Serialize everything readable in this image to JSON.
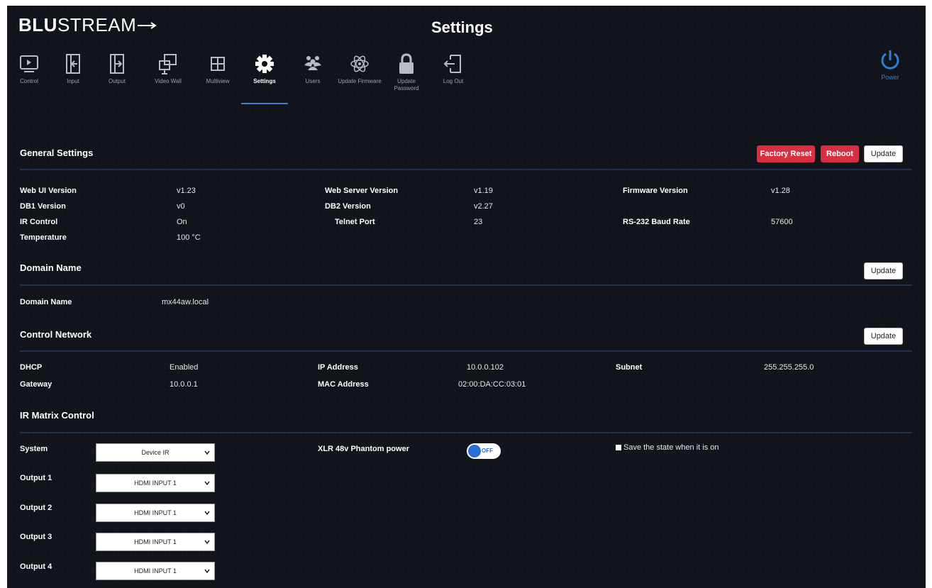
{
  "header": {
    "logo_bold": "BLU",
    "logo_light": "STREAM",
    "title": "Settings"
  },
  "nav": [
    {
      "label": "Control",
      "icon": "control-screen-icon"
    },
    {
      "label": "Input",
      "icon": "input-icon"
    },
    {
      "label": "Output",
      "icon": "output-icon"
    },
    {
      "label": "Video Wall",
      "icon": "video-wall-icon"
    },
    {
      "label": "Multiview",
      "icon": "multiview-icon"
    },
    {
      "label": "Settings",
      "icon": "gear-icon",
      "active": true
    },
    {
      "label": "Users",
      "icon": "users-icon"
    },
    {
      "label": "Update Firmware",
      "icon": "atom-icon"
    },
    {
      "label": "Update Password",
      "icon": "lock-icon"
    },
    {
      "label": "Log Out",
      "icon": "logout-icon"
    }
  ],
  "power": {
    "label": "Power",
    "icon": "power-icon"
  },
  "general": {
    "title": "General Settings",
    "factory_reset": "Factory Reset",
    "reboot": "Reboot",
    "update": "Update",
    "web_ui_version_label": "Web UI Version",
    "web_ui_version": "v1.23",
    "web_server_version_label": "Web Server Version",
    "web_server_version": "v1.19",
    "firmware_version_label": "Firmware Version",
    "firmware_version": "v1.28",
    "db1_version_label": "DB1 Version",
    "db1_version": "v0",
    "db2_version_label": "DB2 Version",
    "db2_version": "v2.27",
    "ir_control_label": "IR Control",
    "ir_control": "On",
    "telnet_port_label": "Telnet Port",
    "telnet_port": "23",
    "baud_rate_label": "RS-232 Baud Rate",
    "baud_rate": "57600",
    "temperature_label": "Temperature",
    "temperature": "100 °C"
  },
  "domain": {
    "title": "Domain Name",
    "update": "Update",
    "label": "Domain Name",
    "value": "mx44aw.local"
  },
  "network": {
    "title": "Control Network",
    "update": "Update",
    "dhcp_label": "DHCP",
    "dhcp": "Enabled",
    "ip_label": "IP Address",
    "ip": "10.0.0.102",
    "subnet_label": "Subnet",
    "subnet": "255.255.255.0",
    "gateway_label": "Gateway",
    "gateway": "10.0.0.1",
    "mac_label": "MAC Address",
    "mac": "02:00:DA:CC:03:01"
  },
  "ir_matrix": {
    "title": "IR Matrix Control",
    "system_label": "System",
    "system_value": "Device IR",
    "outputs": [
      {
        "label": "Output 1",
        "value": "HDMI INPUT 1"
      },
      {
        "label": "Output 2",
        "value": "HDMI INPUT 1"
      },
      {
        "label": "Output 3",
        "value": "HDMI INPUT 1"
      },
      {
        "label": "Output 4",
        "value": "HDMI INPUT 1"
      }
    ],
    "phantom_label": "XLR 48v Phantom power",
    "phantom_state": "OFF",
    "save_state_label": "Save the state when it is on"
  },
  "colors": {
    "background": "#11141b",
    "accent_blue": "#2f7fd8",
    "danger_red": "#d63042"
  }
}
